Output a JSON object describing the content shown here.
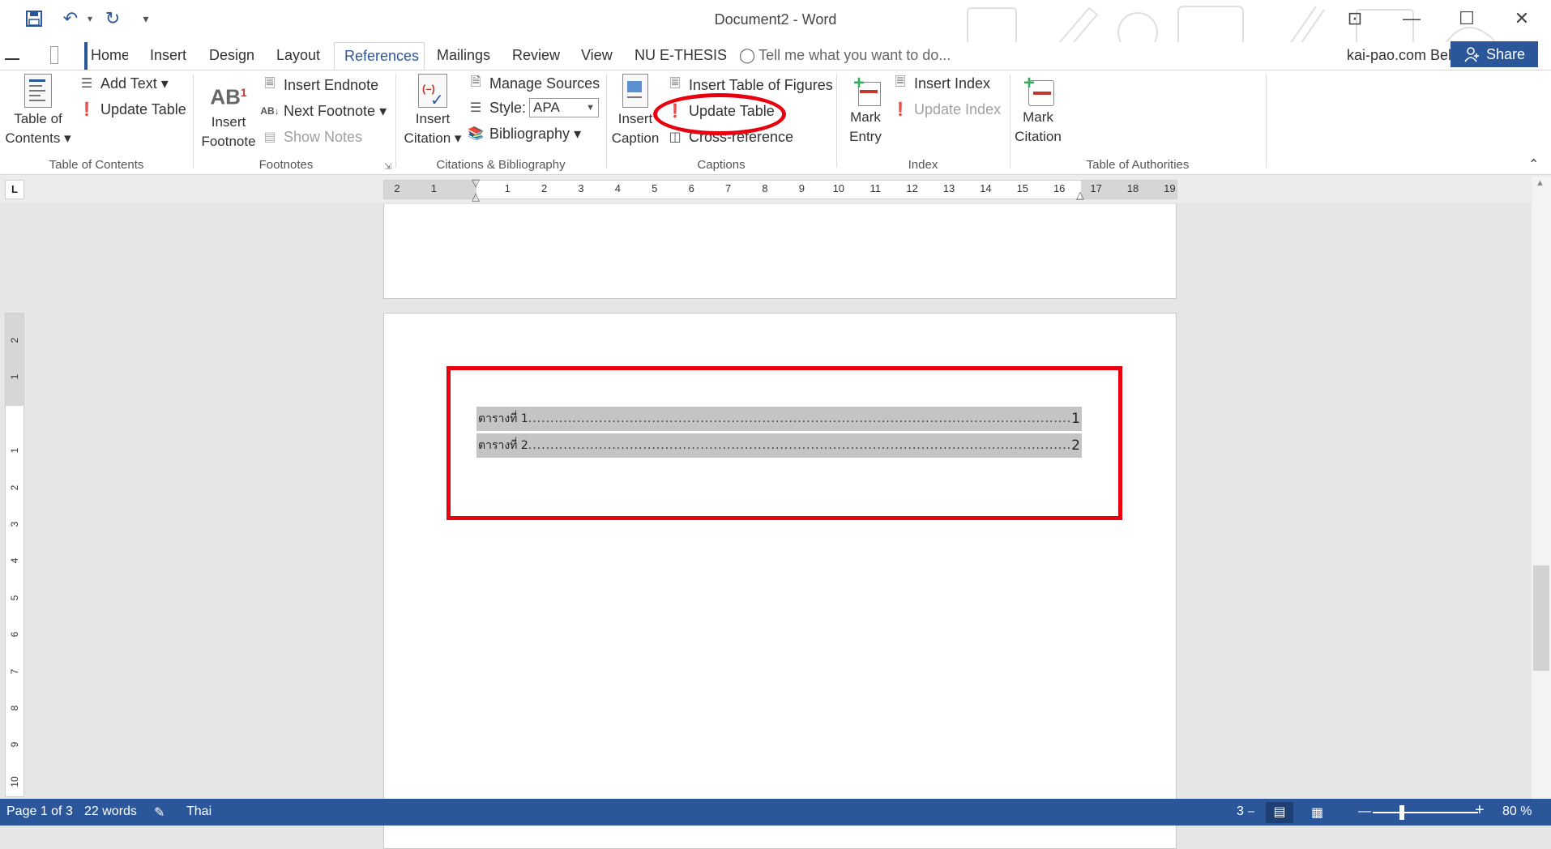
{
  "window": {
    "title": "Document2 - Word",
    "user": "kai-pao.com Bell",
    "share_label": "Share",
    "qat_more": "▾",
    "minimize": "—",
    "maximize": "☐",
    "close": "✕",
    "ribbon_display": "⊡"
  },
  "tabs": [
    {
      "label": "Home",
      "active": false
    },
    {
      "label": "Insert",
      "active": false
    },
    {
      "label": "Design",
      "active": false
    },
    {
      "label": "Layout",
      "active": false
    },
    {
      "label": "References",
      "active": true
    },
    {
      "label": "Mailings",
      "active": false
    },
    {
      "label": "Review",
      "active": false
    },
    {
      "label": "View",
      "active": false
    },
    {
      "label": "NU E-THESIS",
      "active": false
    }
  ],
  "tell_me": "Tell me what you want to do...",
  "ribbon": {
    "toc": {
      "table_of_contents": "Table of",
      "table_of_contents2": "Contents ▾",
      "add_text": "Add Text ▾",
      "update_table": "Update Table",
      "group": "Table of Contents"
    },
    "footnotes": {
      "insert_footnote": "Insert",
      "insert_footnote2": "Footnote",
      "ab_glyph": "AB",
      "sup_glyph": "1",
      "insert_endnote": "Insert Endnote",
      "next_footnote": "Next Footnote ▾",
      "show_notes": "Show Notes",
      "group": "Footnotes"
    },
    "citations": {
      "insert_citation": "Insert",
      "insert_citation2": "Citation ▾",
      "manage_sources": "Manage Sources",
      "style_label": "Style:",
      "style_value": "APA",
      "bibliography": "Bibliography ▾",
      "group": "Citations & Bibliography"
    },
    "captions": {
      "insert_caption": "Insert",
      "insert_caption2": "Caption",
      "insert_tof": "Insert Table of Figures",
      "update_table": "Update Table",
      "cross_reference": "Cross-reference",
      "group": "Captions"
    },
    "index": {
      "mark_entry": "Mark",
      "mark_entry2": "Entry",
      "insert_index": "Insert Index",
      "update_index": "Update Index",
      "group": "Index"
    },
    "authorities": {
      "mark_citation": "Mark",
      "mark_citation2": "Citation",
      "group": "Table of Authorities"
    }
  },
  "ruler": {
    "tab_selector": "L",
    "h_marks": [
      "2",
      "1",
      "",
      "1",
      "2",
      "3",
      "4",
      "5",
      "6",
      "7",
      "8",
      "9",
      "10",
      "11",
      "12",
      "13",
      "14",
      "15",
      "16",
      "17",
      "18",
      "19"
    ],
    "v_marks": [
      "2",
      "1",
      "",
      "1",
      "2",
      "3",
      "4",
      "5",
      "6",
      "7",
      "8",
      "9",
      "10"
    ]
  },
  "document": {
    "entries": [
      {
        "label": "ตารางที่ 1",
        "dots": "....................................................................................................................................................................................................",
        "page": "1"
      },
      {
        "label": "ตารางที่ 2",
        "dots": "....................................................................................................................................................................................................",
        "page": "2"
      }
    ]
  },
  "status": {
    "page": "Page 1 of 3",
    "words": "22 words",
    "language": "Thai",
    "zoom": "80 %",
    "partial": "3"
  }
}
